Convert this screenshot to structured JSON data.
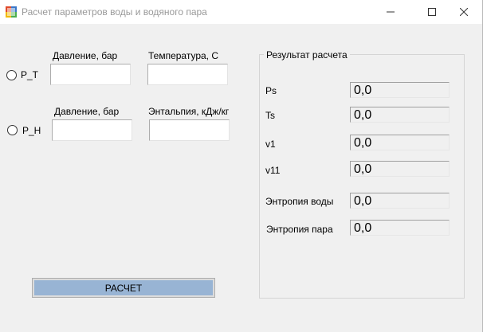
{
  "window": {
    "title": "Расчет параметров воды и водяного пара",
    "controls": {
      "minimize": "minimize-icon",
      "maximize": "maximize-icon",
      "close": "close-icon"
    }
  },
  "modes": {
    "pt": {
      "radio_label": "P_T",
      "selected": false,
      "pressure_label": "Давление, бар",
      "temperature_label": "Температура, C",
      "pressure_value": "",
      "temperature_value": ""
    },
    "ph": {
      "radio_label": "P_H",
      "selected": false,
      "pressure_label": "Давление, бар",
      "enthalpy_label": "Энтальпия, кДж/кг",
      "pressure_value": "",
      "enthalpy_value": ""
    }
  },
  "results": {
    "title": "Результат расчета",
    "items": [
      {
        "label": "Ps",
        "value": "0,0"
      },
      {
        "label": "Ts",
        "value": "0,0"
      },
      {
        "label": "v1",
        "value": "0,0"
      },
      {
        "label": "v11",
        "value": "0,0"
      },
      {
        "label": "Энтропия воды",
        "value": "0,0"
      },
      {
        "label": "Энтропия пара",
        "value": "0,0"
      }
    ]
  },
  "actions": {
    "calculate_label": "РАСЧЕТ"
  }
}
